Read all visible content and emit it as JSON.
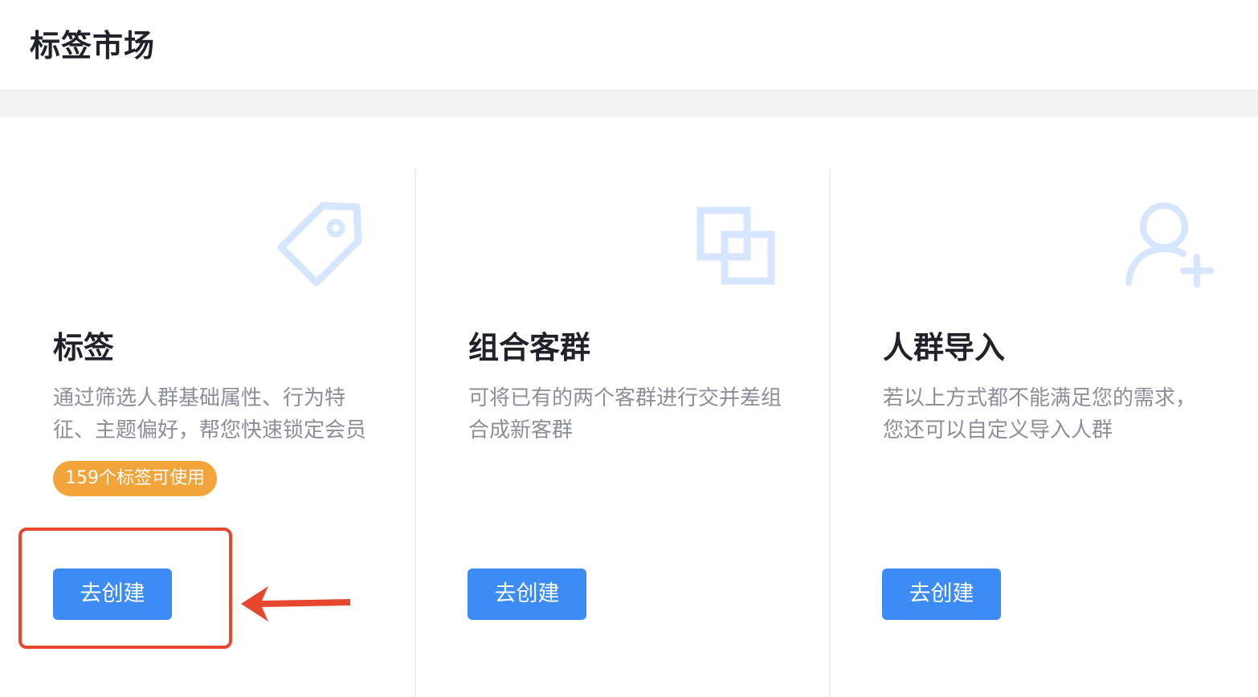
{
  "header": {
    "title": "标签市场"
  },
  "cards": [
    {
      "icon": "tag-icon",
      "title": "标签",
      "desc_lines": [
        "通过筛选人群基础属性、行为特",
        "征、主题偏好，帮您快速锁定会员"
      ],
      "badge": "159个标签可使用",
      "button": "去创建"
    },
    {
      "icon": "overlap-squares-icon",
      "title": "组合客群",
      "desc_lines": [
        "可将已有的两个客群进行交并差组",
        "合成新客群"
      ],
      "button": "去创建"
    },
    {
      "icon": "user-add-icon",
      "title": "人群导入",
      "desc_lines": [
        "若以上方式都不能满足您的需求，",
        "您还可以自定义导入人群"
      ],
      "button": "去创建"
    }
  ],
  "colors": {
    "primary": "#3d8cf5",
    "badge": "#f2a43a",
    "icon": "#d6e6ff",
    "annotation": "#e8472f"
  }
}
